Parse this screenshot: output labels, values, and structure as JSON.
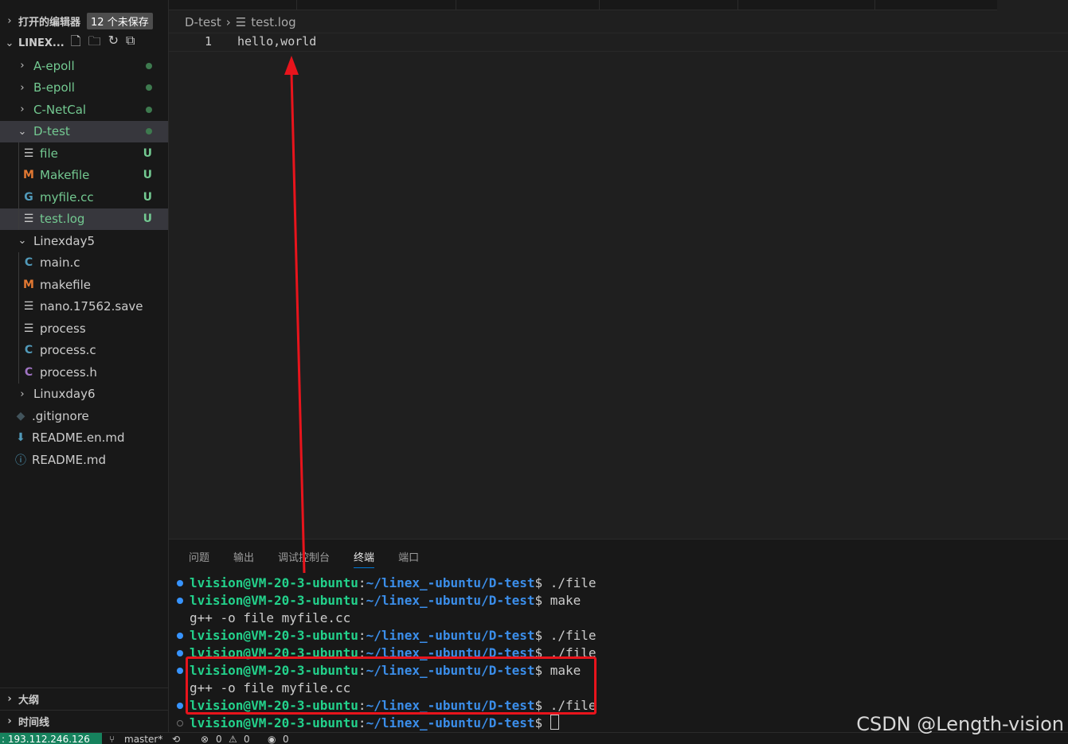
{
  "sidebar": {
    "open_editors": {
      "title": "打开的编辑器",
      "badge": "12 个未保存"
    },
    "root": {
      "title": "LINEX..."
    },
    "tree": [
      {
        "label": "A-epoll",
        "type": "folder",
        "expanded": false,
        "status": "dot"
      },
      {
        "label": "B-epoll",
        "type": "folder",
        "expanded": false,
        "status": "dot"
      },
      {
        "label": "C-NetCal",
        "type": "folder",
        "expanded": false,
        "status": "dot"
      },
      {
        "label": "D-test",
        "type": "folder",
        "expanded": true,
        "status": "dot"
      },
      {
        "label": "file",
        "type": "file",
        "icon": "lines-icon",
        "status": "U"
      },
      {
        "label": "Makefile",
        "type": "file",
        "icon": "makefile-icon",
        "status": "U"
      },
      {
        "label": "myfile.cc",
        "type": "file",
        "icon": "cpp-icon",
        "status": "U"
      },
      {
        "label": "test.log",
        "type": "file",
        "icon": "lines-icon",
        "status": "U"
      },
      {
        "label": "Linexday5",
        "type": "folder",
        "expanded": true
      },
      {
        "label": "main.c",
        "type": "file",
        "icon": "c-icon"
      },
      {
        "label": "makefile",
        "type": "file",
        "icon": "makefile-icon"
      },
      {
        "label": "nano.17562.save",
        "type": "file",
        "icon": "lines-icon"
      },
      {
        "label": "process",
        "type": "file",
        "icon": "lines-icon"
      },
      {
        "label": "process.c",
        "type": "file",
        "icon": "c-icon"
      },
      {
        "label": "process.h",
        "type": "file",
        "icon": "c-header-icon"
      },
      {
        "label": "Linuxday6",
        "type": "folder",
        "expanded": false
      },
      {
        "label": ".gitignore",
        "type": "file",
        "icon": "git-icon"
      },
      {
        "label": "README.en.md",
        "type": "file",
        "icon": "download-icon"
      },
      {
        "label": "README.md",
        "type": "file",
        "icon": "info-icon"
      }
    ],
    "outline": "大纲",
    "timeline": "时间线"
  },
  "editor": {
    "breadcrumb": {
      "folder": "D-test",
      "file": "test.log"
    },
    "lines": [
      {
        "number": "1",
        "text": "hello,world"
      }
    ]
  },
  "panel": {
    "tabs": [
      "问题",
      "输出",
      "调试控制台",
      "终端",
      "端口"
    ],
    "active_tab": "终端",
    "terminal": [
      {
        "user": "lvision@VM-20-3-ubuntu",
        "path": "~/linex_-ubuntu/D-test",
        "cmd": " ./file",
        "dot": "filled"
      },
      {
        "user": "lvision@VM-20-3-ubuntu",
        "path": "~/linex_-ubuntu/D-test",
        "cmd": " make",
        "dot": "filled"
      },
      {
        "output": "g++ -o file myfile.cc"
      },
      {
        "user": "lvision@VM-20-3-ubuntu",
        "path": "~/linex_-ubuntu/D-test",
        "cmd": " ./file",
        "dot": "filled"
      },
      {
        "user": "lvision@VM-20-3-ubuntu",
        "path": "~/linex_-ubuntu/D-test",
        "cmd": " ./file",
        "dot": "filled"
      },
      {
        "user": "lvision@VM-20-3-ubuntu",
        "path": "~/linex_-ubuntu/D-test",
        "cmd": " make",
        "dot": "filled"
      },
      {
        "output": "g++ -o file myfile.cc"
      },
      {
        "user": "lvision@VM-20-3-ubuntu",
        "path": "~/linex_-ubuntu/D-test",
        "cmd": " ./file",
        "dot": "filled"
      },
      {
        "user": "lvision@VM-20-3-ubuntu",
        "path": "~/linex_-ubuntu/D-test",
        "cmd": " ",
        "dot": "hollow",
        "cursor": true
      }
    ]
  },
  "statusbar": {
    "remote": ": 193.112.246.126",
    "branch": "master*",
    "errors": "0",
    "warnings": "0",
    "ports": "0"
  },
  "watermark": "CSDN @Length-vision",
  "colors": {
    "annotation_red": "#e8141c",
    "terminal_user": "#23d18b",
    "terminal_path": "#3b8eea",
    "git_untracked": "#73c991"
  }
}
